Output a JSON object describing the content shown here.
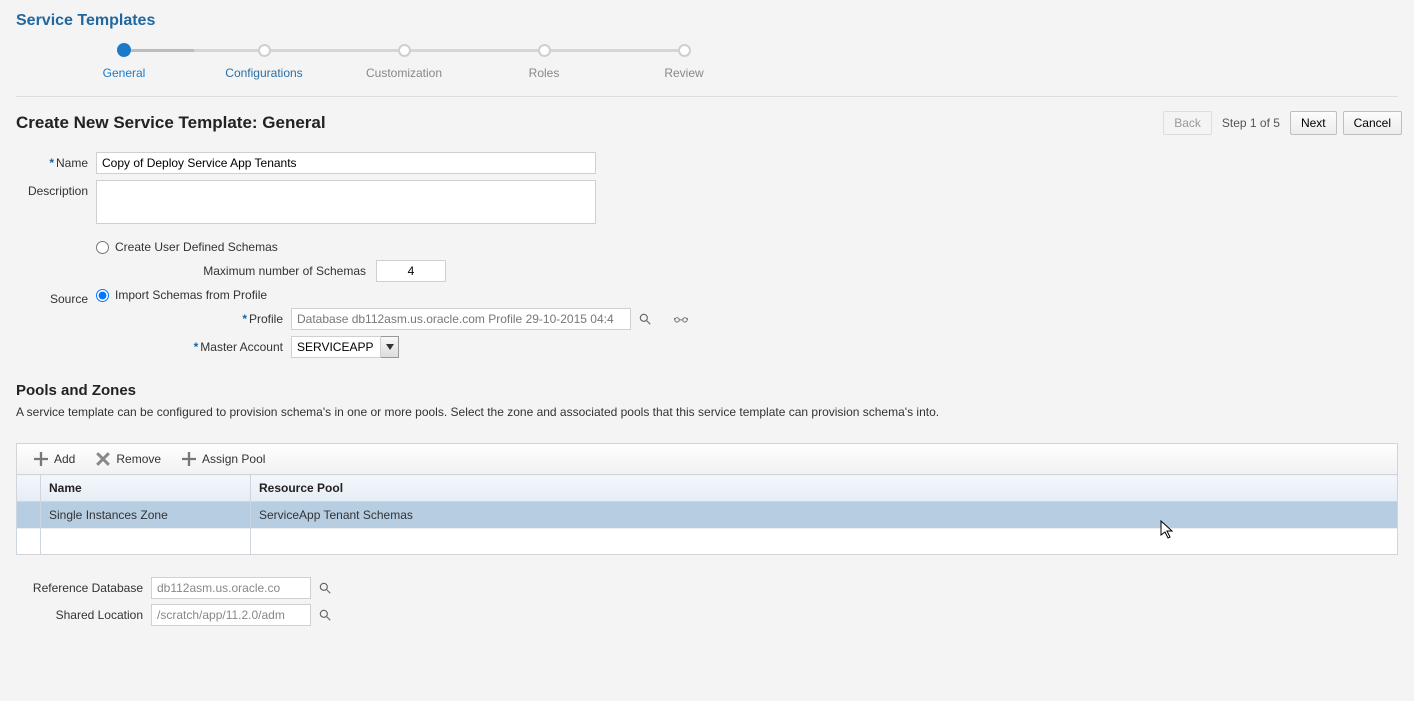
{
  "page": {
    "title": "Service Templates",
    "section_title": "Create New Service Template: General",
    "step_indicator": "Step 1 of 5"
  },
  "buttons": {
    "back": "Back",
    "next": "Next",
    "cancel": "Cancel"
  },
  "wizard": {
    "steps": [
      {
        "label": "General",
        "state": "current"
      },
      {
        "label": "Configurations",
        "state": "next-link"
      },
      {
        "label": "Customization",
        "state": "future"
      },
      {
        "label": "Roles",
        "state": "future"
      },
      {
        "label": "Review",
        "state": "future"
      }
    ]
  },
  "form": {
    "name_label": "Name",
    "name_value": "Copy of Deploy Service App Tenants",
    "description_label": "Description",
    "description_value": "",
    "source_label": "Source",
    "source_option_create": "Create User Defined Schemas",
    "source_option_import": "Import Schemas from Profile",
    "source_selected": "import",
    "max_schemas_label": "Maximum number of Schemas",
    "max_schemas_value": "4",
    "profile_label": "Profile",
    "profile_value": "Database db112asm.us.oracle.com Profile 29-10-2015 04:4",
    "master_account_label": "Master Account",
    "master_account_value": "SERVICEAPP"
  },
  "pools": {
    "heading": "Pools and Zones",
    "help": "A service template can be configured to provision schema's in one or more pools. Select the zone and associated pools that this service template can provision schema's into.",
    "toolbar": {
      "add": "Add",
      "remove": "Remove",
      "assign_pool": "Assign Pool"
    },
    "columns": {
      "name": "Name",
      "resource_pool": "Resource Pool"
    },
    "rows": [
      {
        "name": "Single Instances Zone",
        "resource_pool": "ServiceApp Tenant Schemas",
        "selected": true
      }
    ]
  },
  "ref": {
    "database_label": "Reference Database",
    "database_value": "db112asm.us.oracle.co",
    "shared_loc_label": "Shared Location",
    "shared_loc_value": "/scratch/app/11.2.0/adm"
  }
}
